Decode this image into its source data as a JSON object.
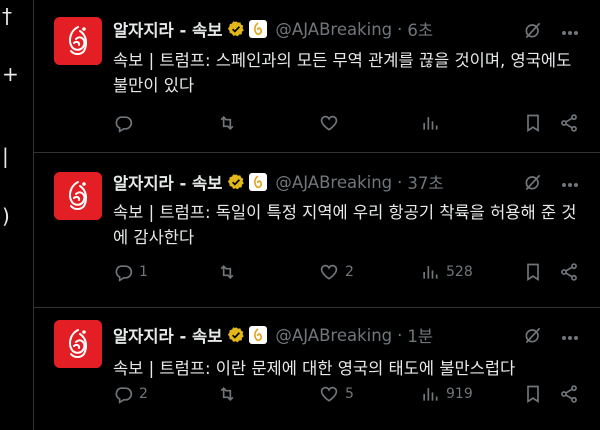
{
  "colors": {
    "background": "#000000",
    "text": "#e7e9ea",
    "muted": "#71767b",
    "avatar_red": "#e31e24",
    "divider": "#2f3336",
    "verified_gold": "#e2b719"
  },
  "tweets": [
    {
      "name": "알자지라 - 속보",
      "handle": "@AJABreaking",
      "separator": "·",
      "time": "6초",
      "text": "속보 | 트럼프: 스페인과의 모든 무역 관계를 끊을 것이며, 영국에도 불만이 있다",
      "replies": "",
      "retweets": "",
      "likes": "",
      "views": ""
    },
    {
      "name": "알자지라 - 속보",
      "handle": "@AJABreaking",
      "separator": "·",
      "time": "37초",
      "text": "속보 | 트럼프: 독일이 특정 지역에 우리 항공기 착륙을 허용해 준 것에 감사한다",
      "replies": "1",
      "retweets": "",
      "likes": "2",
      "views": "528"
    },
    {
      "name": "알자지라 - 속보",
      "handle": "@AJABreaking",
      "separator": "·",
      "time": "1분",
      "text": "속보 | 트럼프: 이란 문제에 대한 영국의 태도에 불만스럽다",
      "replies": "2",
      "retweets": "",
      "likes": "5",
      "views": "919"
    }
  ],
  "icons": [
    "reply-icon",
    "retweet-icon",
    "like-icon",
    "views-icon",
    "bookmark-icon",
    "share-icon",
    "grok-icon",
    "more-icon",
    "verified-badge-icon",
    "affiliate-badge-icon",
    "al-jazeera-logo"
  ]
}
